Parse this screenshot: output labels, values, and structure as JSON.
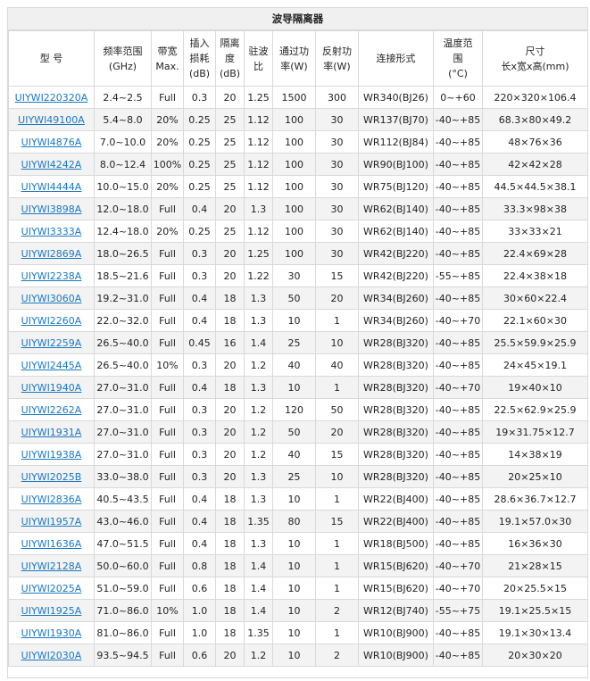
{
  "caption": "波导隔离器",
  "headers": [
    [
      "型 号"
    ],
    [
      "频率范围",
      "(GHz)"
    ],
    [
      "带宽",
      "Max."
    ],
    [
      "插入",
      "损耗",
      "(dB)"
    ],
    [
      "隔离",
      "度",
      "(dB)"
    ],
    [
      "驻波",
      "比"
    ],
    [
      "通过功",
      "率(W)"
    ],
    [
      "反射功",
      "率(W)"
    ],
    [
      "连接形式"
    ],
    [
      "温度范",
      "围",
      "(°C)"
    ],
    [
      "尺寸",
      "长x宽x高(mm)"
    ]
  ],
  "rows": [
    [
      "UIYWI220320A",
      "2.4~2.5",
      "Full",
      "0.3",
      "20",
      "1.25",
      "1500",
      "300",
      "WR340(BJ26)",
      "0~+60",
      "220×320×106.4"
    ],
    [
      "UIYWI49100A",
      "5.4~8.0",
      "20%",
      "0.25",
      "25",
      "1.12",
      "100",
      "30",
      "WR137(BJ70)",
      "-40~+85",
      "68.3×80×49.2"
    ],
    [
      "UIYWI4876A",
      "7.0~10.0",
      "20%",
      "0.25",
      "25",
      "1.12",
      "100",
      "30",
      "WR112(BJ84)",
      "-40~+85",
      "48×76×36"
    ],
    [
      "UIYWI4242A",
      "8.0~12.4",
      "100%",
      "0.25",
      "25",
      "1.12",
      "100",
      "30",
      "WR90(BJ100)",
      "-40~+85",
      "42×42×28"
    ],
    [
      "UIYWI4444A",
      "10.0~15.0",
      "20%",
      "0.25",
      "25",
      "1.12",
      "100",
      "30",
      "WR75(BJ120)",
      "-40~+85",
      "44.5×44.5×38.1"
    ],
    [
      "UIYWI3898A",
      "12.0~18.0",
      "Full",
      "0.4",
      "20",
      "1.3",
      "100",
      "30",
      "WR62(BJ140)",
      "-40~+85",
      "33.3×98×38"
    ],
    [
      "UIYWI3333A",
      "12.4~18.0",
      "20%",
      "0.25",
      "25",
      "1.12",
      "100",
      "30",
      "WR62(BJ140)",
      "-40~+85",
      "33×33×21"
    ],
    [
      "UIYWI2869A",
      "18.0~26.5",
      "Full",
      "0.3",
      "20",
      "1.25",
      "100",
      "30",
      "WR42(BJ220)",
      "-40~+85",
      "22.4×69×28"
    ],
    [
      "UIYWI2238A",
      "18.5~21.6",
      "Full",
      "0.3",
      "20",
      "1.22",
      "30",
      "15",
      "WR42(BJ220)",
      "-55~+85",
      "22.4×38×18"
    ],
    [
      "UIYWI3060A",
      "19.2~31.0",
      "Full",
      "0.4",
      "18",
      "1.3",
      "50",
      "20",
      "WR34(BJ260)",
      "-40~+85",
      "30×60×22.4"
    ],
    [
      "UIYWI2260A",
      "22.0~32.0",
      "Full",
      "0.4",
      "18",
      "1.3",
      "10",
      "1",
      "WR34(BJ260)",
      "-40~+70",
      "22.1×60×30"
    ],
    [
      "UIYWI2259A",
      "26.5~40.0",
      "Full",
      "0.45",
      "16",
      "1.4",
      "25",
      "10",
      "WR28(BJ320)",
      "-40~+85",
      "25.5×59.9×25.9"
    ],
    [
      "UIYWI2445A",
      "26.5~40.0",
      "10%",
      "0.3",
      "20",
      "1.2",
      "40",
      "40",
      "WR28(BJ320)",
      "-40~+85",
      "24×45×19.1"
    ],
    [
      "UIYWI1940A",
      "27.0~31.0",
      "Full",
      "0.4",
      "18",
      "1.3",
      "10",
      "1",
      "WR28(BJ320)",
      "-40~+70",
      "19×40×10"
    ],
    [
      "UIYWI2262A",
      "27.0~31.0",
      "Full",
      "0.3",
      "20",
      "1.2",
      "120",
      "50",
      "WR28(BJ320)",
      "-40~+85",
      "22.5×62.9×25.9"
    ],
    [
      "UIYWI1931A",
      "27.0~31.0",
      "Full",
      "0.3",
      "20",
      "1.2",
      "50",
      "20",
      "WR28(BJ320)",
      "-40~+85",
      "19×31.75×12.7"
    ],
    [
      "UIYWI1938A",
      "27.0~31.0",
      "Full",
      "0.3",
      "20",
      "1.2",
      "40",
      "15",
      "WR28(BJ320)",
      "-40~+85",
      "14×38×19"
    ],
    [
      "UIYWI2025B",
      "33.0~38.0",
      "Full",
      "0.3",
      "20",
      "1.3",
      "25",
      "10",
      "WR28(BJ320)",
      "-40~+85",
      "20×25×10"
    ],
    [
      "UIYWI2836A",
      "40.5~43.5",
      "Full",
      "0.4",
      "18",
      "1.3",
      "10",
      "1",
      "WR22(BJ400)",
      "-40~+85",
      "28.6×36.7×12.7"
    ],
    [
      "UIYWI1957A",
      "43.0~46.0",
      "Full",
      "0.4",
      "18",
      "1.35",
      "80",
      "15",
      "WR22(BJ400)",
      "-40~+85",
      "19.1×57.0×30"
    ],
    [
      "UIYWI1636A",
      "47.0~51.5",
      "Full",
      "0.4",
      "18",
      "1.3",
      "10",
      "1",
      "WR18(BJ500)",
      "-40~+85",
      "16×36×30"
    ],
    [
      "UIYWI2128A",
      "50.0~60.0",
      "Full",
      "0.8",
      "18",
      "1.4",
      "10",
      "1",
      "WR15(BJ620)",
      "-40~+70",
      "21×28×15"
    ],
    [
      "UIYWI2025A",
      "51.0~59.0",
      "Full",
      "0.6",
      "18",
      "1.4",
      "10",
      "1",
      "WR15(BJ620)",
      "-40~+70",
      "20×25.5×15"
    ],
    [
      "UIYWI1925A",
      "71.0~86.0",
      "10%",
      "1.0",
      "18",
      "1.4",
      "10",
      "2",
      "WR12(BJ740)",
      "-55~+75",
      "19.1×25.5×15"
    ],
    [
      "UIYWI1930A",
      "81.0~86.0",
      "Full",
      "1.0",
      "18",
      "1.35",
      "10",
      "1",
      "WR10(BJ900)",
      "-40~+85",
      "19.1×30×13.4"
    ],
    [
      "UIYWI2030A",
      "93.5~94.5",
      "Full",
      "0.6",
      "20",
      "1.2",
      "10",
      "2",
      "WR10(BJ900)",
      "-40~+85",
      "20×30×20"
    ]
  ]
}
